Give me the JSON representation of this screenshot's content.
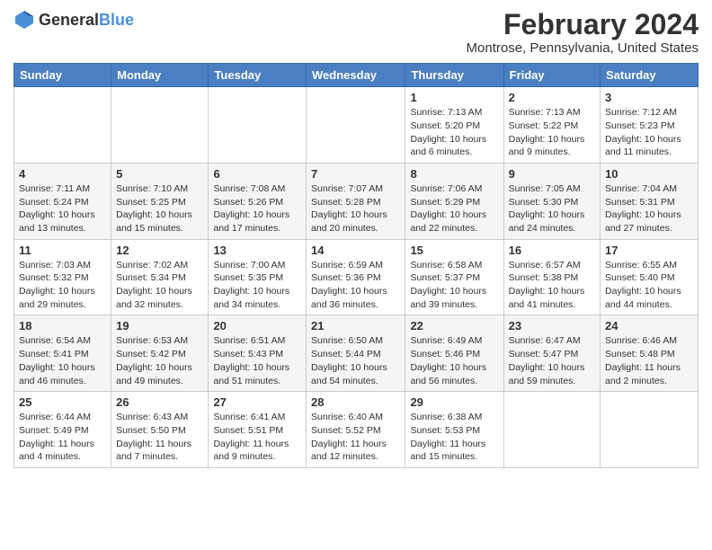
{
  "logo": {
    "general": "General",
    "blue": "Blue"
  },
  "title": "February 2024",
  "subtitle": "Montrose, Pennsylvania, United States",
  "headers": [
    "Sunday",
    "Monday",
    "Tuesday",
    "Wednesday",
    "Thursday",
    "Friday",
    "Saturday"
  ],
  "weeks": [
    [
      {
        "day": "",
        "info": ""
      },
      {
        "day": "",
        "info": ""
      },
      {
        "day": "",
        "info": ""
      },
      {
        "day": "",
        "info": ""
      },
      {
        "day": "1",
        "info": "Sunrise: 7:13 AM\nSunset: 5:20 PM\nDaylight: 10 hours\nand 6 minutes."
      },
      {
        "day": "2",
        "info": "Sunrise: 7:13 AM\nSunset: 5:22 PM\nDaylight: 10 hours\nand 9 minutes."
      },
      {
        "day": "3",
        "info": "Sunrise: 7:12 AM\nSunset: 5:23 PM\nDaylight: 10 hours\nand 11 minutes."
      }
    ],
    [
      {
        "day": "4",
        "info": "Sunrise: 7:11 AM\nSunset: 5:24 PM\nDaylight: 10 hours\nand 13 minutes."
      },
      {
        "day": "5",
        "info": "Sunrise: 7:10 AM\nSunset: 5:25 PM\nDaylight: 10 hours\nand 15 minutes."
      },
      {
        "day": "6",
        "info": "Sunrise: 7:08 AM\nSunset: 5:26 PM\nDaylight: 10 hours\nand 17 minutes."
      },
      {
        "day": "7",
        "info": "Sunrise: 7:07 AM\nSunset: 5:28 PM\nDaylight: 10 hours\nand 20 minutes."
      },
      {
        "day": "8",
        "info": "Sunrise: 7:06 AM\nSunset: 5:29 PM\nDaylight: 10 hours\nand 22 minutes."
      },
      {
        "day": "9",
        "info": "Sunrise: 7:05 AM\nSunset: 5:30 PM\nDaylight: 10 hours\nand 24 minutes."
      },
      {
        "day": "10",
        "info": "Sunrise: 7:04 AM\nSunset: 5:31 PM\nDaylight: 10 hours\nand 27 minutes."
      }
    ],
    [
      {
        "day": "11",
        "info": "Sunrise: 7:03 AM\nSunset: 5:32 PM\nDaylight: 10 hours\nand 29 minutes."
      },
      {
        "day": "12",
        "info": "Sunrise: 7:02 AM\nSunset: 5:34 PM\nDaylight: 10 hours\nand 32 minutes."
      },
      {
        "day": "13",
        "info": "Sunrise: 7:00 AM\nSunset: 5:35 PM\nDaylight: 10 hours\nand 34 minutes."
      },
      {
        "day": "14",
        "info": "Sunrise: 6:59 AM\nSunset: 5:36 PM\nDaylight: 10 hours\nand 36 minutes."
      },
      {
        "day": "15",
        "info": "Sunrise: 6:58 AM\nSunset: 5:37 PM\nDaylight: 10 hours\nand 39 minutes."
      },
      {
        "day": "16",
        "info": "Sunrise: 6:57 AM\nSunset: 5:38 PM\nDaylight: 10 hours\nand 41 minutes."
      },
      {
        "day": "17",
        "info": "Sunrise: 6:55 AM\nSunset: 5:40 PM\nDaylight: 10 hours\nand 44 minutes."
      }
    ],
    [
      {
        "day": "18",
        "info": "Sunrise: 6:54 AM\nSunset: 5:41 PM\nDaylight: 10 hours\nand 46 minutes."
      },
      {
        "day": "19",
        "info": "Sunrise: 6:53 AM\nSunset: 5:42 PM\nDaylight: 10 hours\nand 49 minutes."
      },
      {
        "day": "20",
        "info": "Sunrise: 6:51 AM\nSunset: 5:43 PM\nDaylight: 10 hours\nand 51 minutes."
      },
      {
        "day": "21",
        "info": "Sunrise: 6:50 AM\nSunset: 5:44 PM\nDaylight: 10 hours\nand 54 minutes."
      },
      {
        "day": "22",
        "info": "Sunrise: 6:49 AM\nSunset: 5:46 PM\nDaylight: 10 hours\nand 56 minutes."
      },
      {
        "day": "23",
        "info": "Sunrise: 6:47 AM\nSunset: 5:47 PM\nDaylight: 10 hours\nand 59 minutes."
      },
      {
        "day": "24",
        "info": "Sunrise: 6:46 AM\nSunset: 5:48 PM\nDaylight: 11 hours\nand 2 minutes."
      }
    ],
    [
      {
        "day": "25",
        "info": "Sunrise: 6:44 AM\nSunset: 5:49 PM\nDaylight: 11 hours\nand 4 minutes."
      },
      {
        "day": "26",
        "info": "Sunrise: 6:43 AM\nSunset: 5:50 PM\nDaylight: 11 hours\nand 7 minutes."
      },
      {
        "day": "27",
        "info": "Sunrise: 6:41 AM\nSunset: 5:51 PM\nDaylight: 11 hours\nand 9 minutes."
      },
      {
        "day": "28",
        "info": "Sunrise: 6:40 AM\nSunset: 5:52 PM\nDaylight: 11 hours\nand 12 minutes."
      },
      {
        "day": "29",
        "info": "Sunrise: 6:38 AM\nSunset: 5:53 PM\nDaylight: 11 hours\nand 15 minutes."
      },
      {
        "day": "",
        "info": ""
      },
      {
        "day": "",
        "info": ""
      }
    ]
  ]
}
